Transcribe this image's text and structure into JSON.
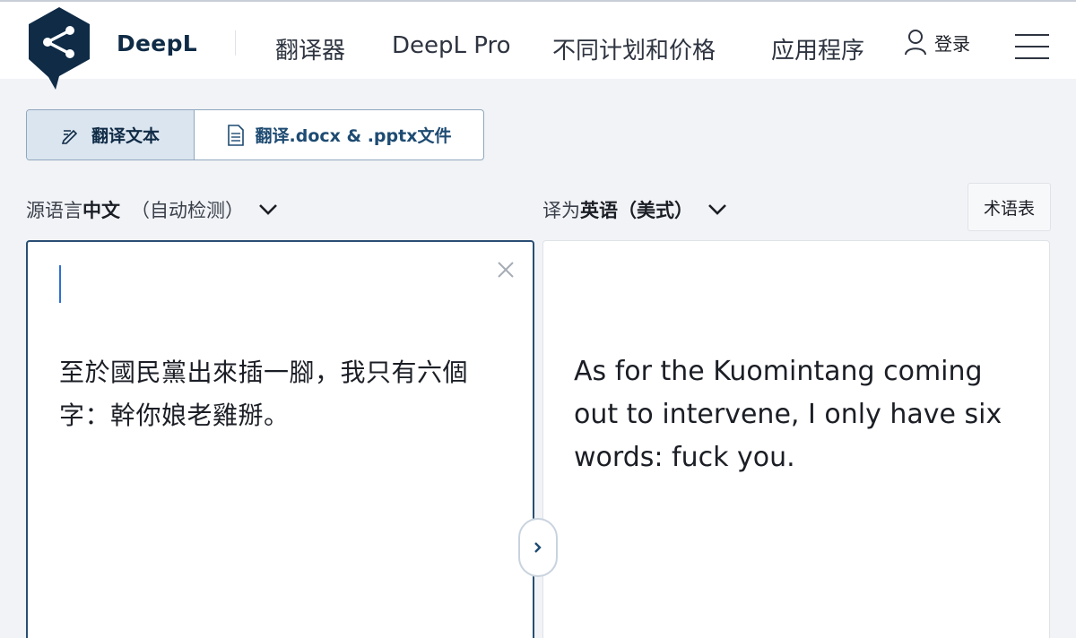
{
  "brand": {
    "name": "DeepL"
  },
  "nav": {
    "translator": "翻译器",
    "pro": "DeepL Pro",
    "plans": "不同计划和价格",
    "apps": "应用程序"
  },
  "login": {
    "label": "登录",
    "icon": "user-icon"
  },
  "menu": {
    "icon": "hamburger-menu-icon"
  },
  "mode_tabs": {
    "text": {
      "label": "翻译文本",
      "icon": "pen-icon",
      "active": true
    },
    "files": {
      "label": "翻译.docx & .pptx文件",
      "icon": "document-icon",
      "active": false
    }
  },
  "source_lang": {
    "prefix": "源语言",
    "name": "中文",
    "detect": "（自动检测）",
    "icon": "chevron-down-icon"
  },
  "target_lang": {
    "prefix": "译为",
    "name": "英语（美式）",
    "icon": "chevron-down-icon"
  },
  "glossary": {
    "label": "术语表"
  },
  "source": {
    "text": "至於國民黨出來插一腳，我只有六個字：幹你娘老雞掰。",
    "clear_icon": "close-icon"
  },
  "target": {
    "text": "As for the Kuomintang coming out to intervene, I only have six words: fuck you."
  },
  "swap": {
    "icon": "chevron-right-icon"
  },
  "colors": {
    "brand_navy": "#0f2b46",
    "active_border": "#2a4e73",
    "caret": "#2f6fd6",
    "background": "#f1f3f6"
  }
}
